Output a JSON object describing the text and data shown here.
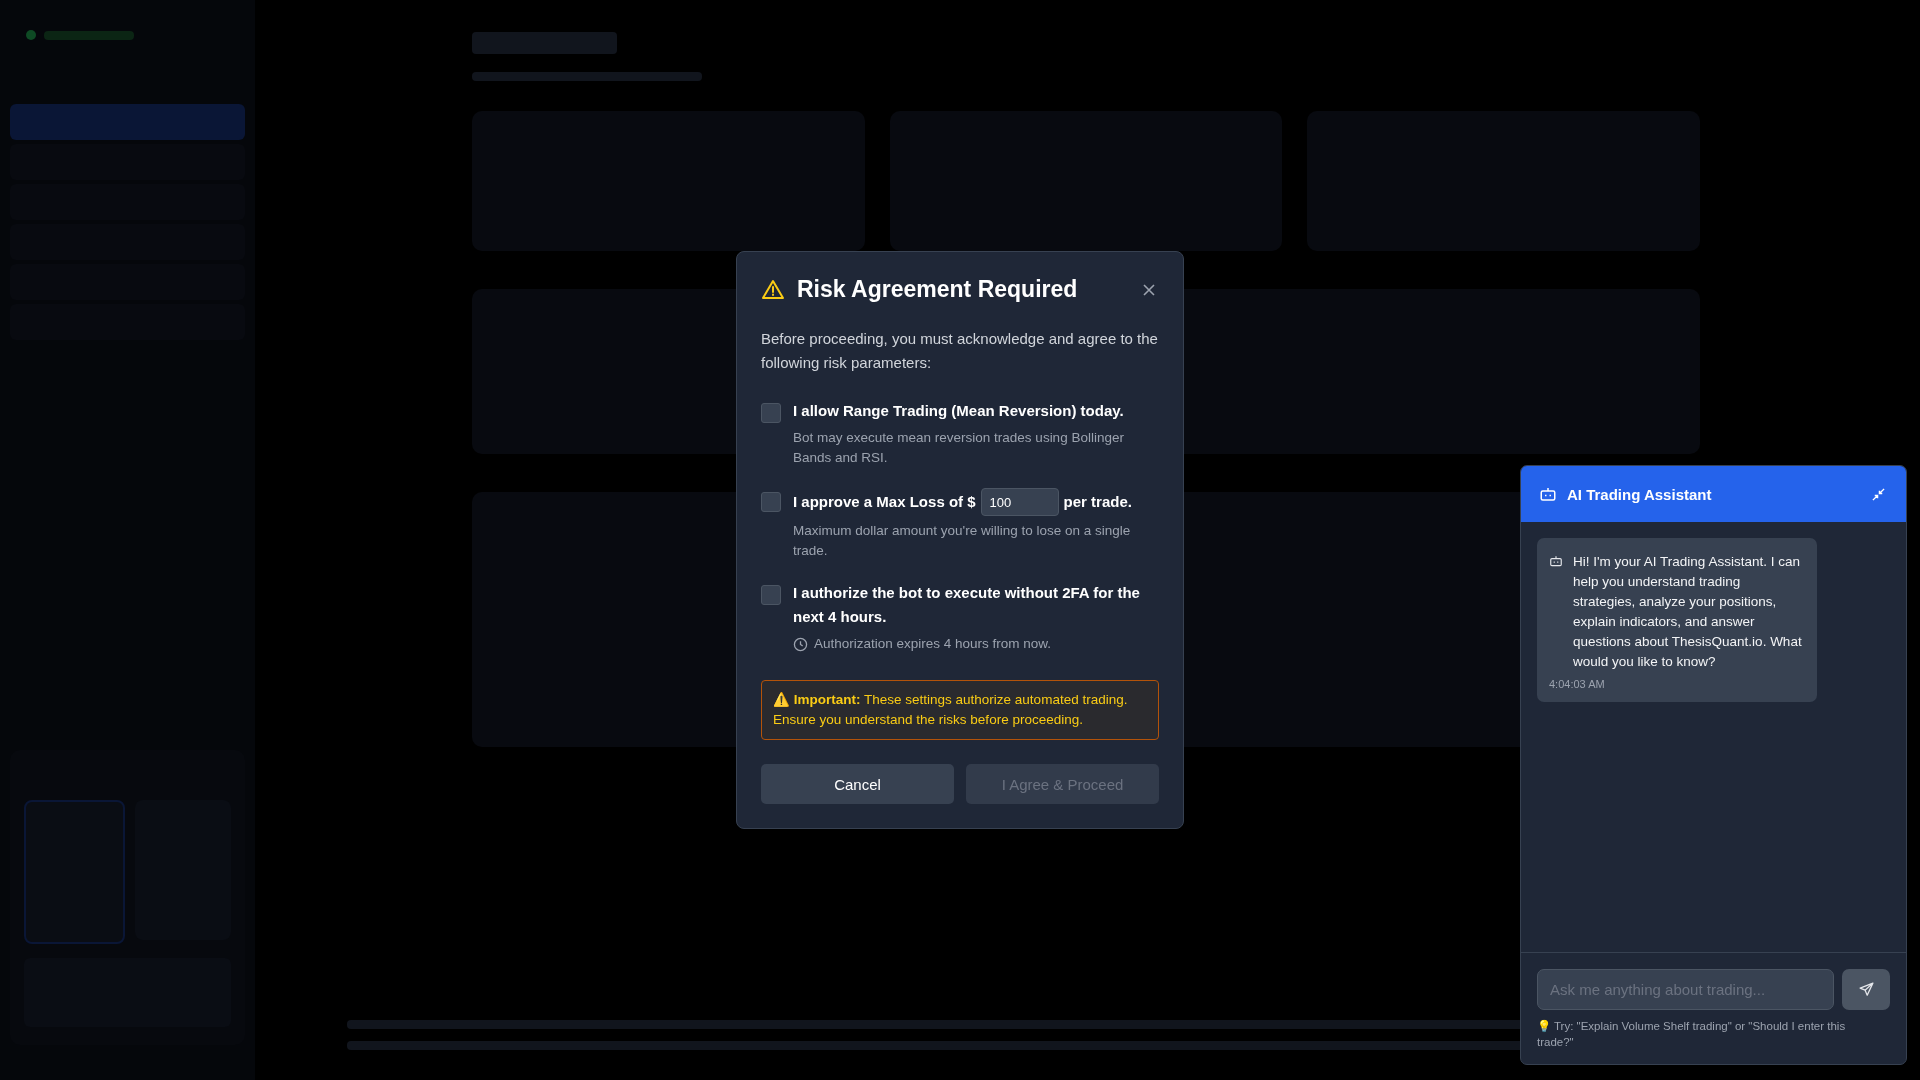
{
  "background": {
    "sidebar_items": [
      {
        "selected": true
      },
      {
        "selected": false
      },
      {
        "selected": false
      },
      {
        "selected": false
      },
      {
        "selected": false
      },
      {
        "selected": false
      }
    ]
  },
  "modal": {
    "title": "Risk Agreement Required",
    "intro": "Before proceeding, you must acknowledge and agree to the following risk parameters:",
    "agreements": [
      {
        "kind": "plain",
        "label": "I allow Range Trading (Mean Reversion) today.",
        "note": "Bot may execute mean reversion trades using Bollinger Bands and RSI.",
        "checked": false
      },
      {
        "kind": "amount",
        "label": "I approve a Max Loss of $",
        "value": "100",
        "label_after": "per trade.",
        "note": "Maximum dollar amount you're willing to lose on a single trade.",
        "checked": false
      },
      {
        "kind": "timed",
        "label": "I authorize the bot to execute without 2FA for the next 4 hours.",
        "note": "Authorization expires 4 hours from now.",
        "checked": false
      }
    ],
    "warning": "⚠️ **Important:** These settings authorize automated trading. Ensure you understand the risks before proceeding.",
    "buttons": [
      {
        "label": "Cancel",
        "disabled": false
      },
      {
        "label": "I Agree & Proceed",
        "disabled": true
      }
    ]
  },
  "chat": {
    "title": "AI Trading Assistant",
    "messages": [
      {
        "text": "Hi! I'm your AI Trading Assistant. I can help you understand trading strategies, analyze your positions, explain indicators, and answer questions about ThesisQuant.io. What would you like to know?",
        "time": "4:04:03 AM"
      }
    ],
    "input": {
      "placeholder": "Ask me anything about trading..."
    },
    "tip": "💡 Try: \"Explain Volume Shelf trading\" or \"Should I enter this trade?\""
  }
}
